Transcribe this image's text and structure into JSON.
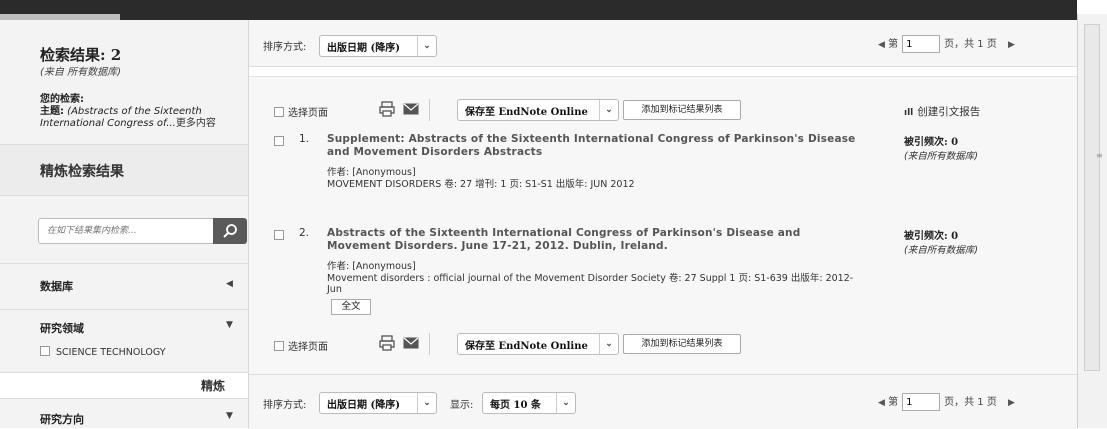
{
  "sidebar": {
    "results_title": "检索结果: 2",
    "results_source": "(来自 所有数据库)",
    "history_heading": "您的检索:",
    "history_topic_label": "主题:",
    "history_topic_value": " (Abstracts of the Sixteenth",
    "history_line2": "International Congress of...",
    "history_more": "更多内容",
    "refine_heading": "精炼检索结果",
    "search_placeholder": "在如下结果集内检索...",
    "sections": [
      {
        "label": "数据库",
        "arrow": "◀"
      },
      {
        "label": "研究领域",
        "arrow": "▼"
      },
      {
        "label": "研究方向",
        "arrow": "▼"
      }
    ],
    "research_area_option": "SCIENCE TECHNOLOGY",
    "refine_button": "精炼"
  },
  "top_bar": {
    "sort_label": "排序方式:",
    "sort_value": "出版日期 (降序)",
    "page_prefix": "第",
    "page_value": "1",
    "page_suffix": "页，共 1 页"
  },
  "actions": {
    "select_page": "选择页面",
    "save_to": "保存至 EndNote Online",
    "add_marked": "添加到标记结果列表",
    "citation_report": "创建引文报告"
  },
  "records": [
    {
      "number": "1.",
      "title": "Supplement: Abstracts of the Sixteenth International Congress of Parkinson's Disease and Movement Disorders Abstracts",
      "authors": "作者: [Anonymous]",
      "source": "MOVEMENT DISORDERS 卷: 27  增刊: 1  页: S1-S1  出版年: JUN 2012",
      "times_cited": "被引频次: 0",
      "cited_source": "(来自所有数据库)"
    },
    {
      "number": "2.",
      "title": "Abstracts of the Sixteenth International Congress of Parkinson's Disease and Movement Disorders. June 17-21, 2012. Dublin, Ireland.",
      "authors": "作者: [Anonymous]",
      "source": "Movement disorders : official journal of the Movement Disorder Society  卷: 27 Suppl 1  页: S1-639  出版年: 2012-Jun",
      "full_text": "全文",
      "times_cited": "被引频次: 0",
      "cited_source": "(来自所有数据库)"
    }
  ],
  "bottom_bar": {
    "sort_label": "排序方式:",
    "sort_value": "出版日期 (降序)",
    "show_label": "显示:",
    "show_value": "每页 10 条",
    "page_prefix": "第",
    "page_value": "1",
    "page_suffix": "页，共 1 页"
  },
  "icons": {
    "sort_chevron": "chevron-down-icon",
    "prev": "prev-page-icon",
    "next": "next-page-icon",
    "search": "search-icon",
    "print": "print-icon",
    "email": "email-icon",
    "report": "bar-chart-icon"
  }
}
